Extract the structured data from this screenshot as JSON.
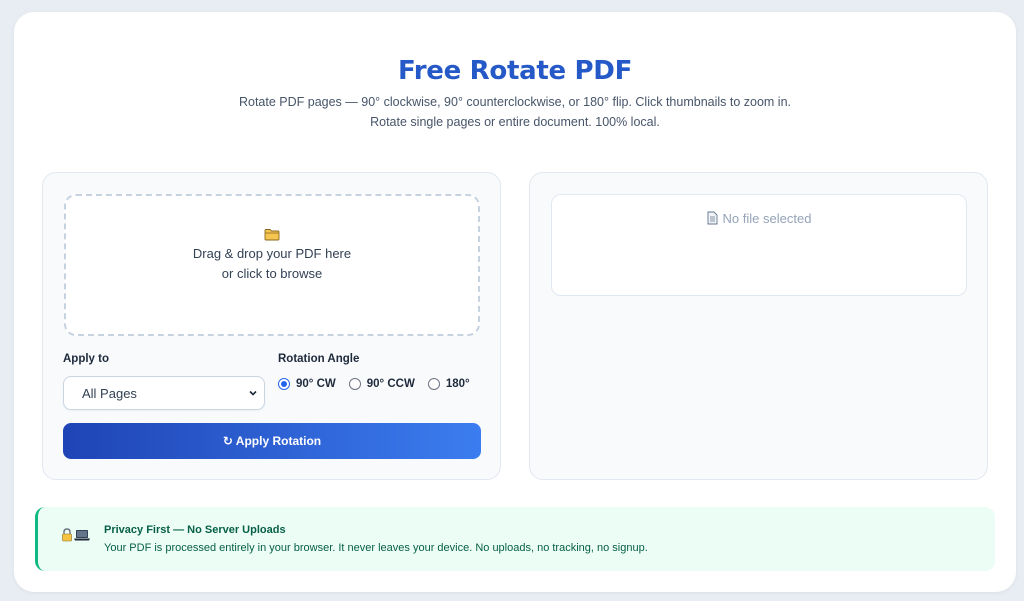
{
  "header": {
    "title": "Free Rotate PDF",
    "subtitle_line1": "Rotate PDF pages — 90° clockwise, 90° counterclockwise, or 180° flip. Click thumbnails to zoom in.",
    "subtitle_line2": "Rotate single pages or entire document. 100% local."
  },
  "upload": {
    "icon": "folder-icon",
    "line1": "Drag & drop your PDF here",
    "line2": "or click to browse"
  },
  "controls": {
    "apply_to_label": "Apply to",
    "apply_to_value": "All Pages",
    "rotation_label": "Rotation Angle",
    "options": [
      {
        "label": "90° CW",
        "selected": true
      },
      {
        "label": "90° CCW",
        "selected": false
      },
      {
        "label": "180°",
        "selected": false
      }
    ],
    "apply_button": "↻ Apply Rotation"
  },
  "preview": {
    "icon": "document-icon",
    "empty_text": "No file selected"
  },
  "privacy": {
    "icons": [
      "lock-icon",
      "laptop-icon"
    ],
    "title": "Privacy First — No Server Uploads",
    "description": "Your PDF is processed entirely in your browser. It never leaves your device. No uploads, no tracking, no signup."
  },
  "colors": {
    "accent": "#2459c7",
    "button_gradient_start": "#1f44b5",
    "button_gradient_end": "#3b7df0",
    "privacy_bg": "#ecfdf5",
    "privacy_border": "#10b981",
    "privacy_text": "#065f46"
  }
}
